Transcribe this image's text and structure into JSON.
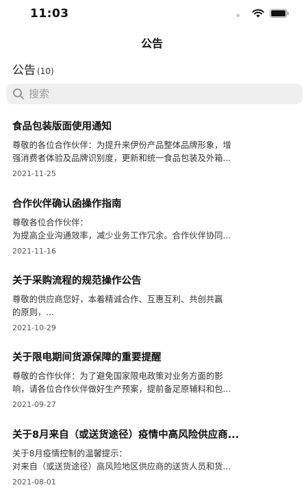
{
  "status_bar": {
    "time": "11:03"
  },
  "nav": {
    "title": "公告"
  },
  "section": {
    "title": "公告",
    "count": "(10)"
  },
  "search": {
    "placeholder": "搜索"
  },
  "notices": [
    {
      "title": "食品包装版面使用通知",
      "lines": [
        "尊敬的各位合作伙伴：为提升来伊份产品整体品牌形象，增",
        "强消费者体验及品牌识别度，更新和统一食品包装及外箱..."
      ],
      "date": "2021-11-25"
    },
    {
      "title": "合作伙伴确认函操作指南",
      "lines": [
        "尊敬各位合作伙伴：",
        "为提高企业沟通效率，减少业务工作冗余。合作伙伴协同..."
      ],
      "date": "2021-11-16"
    },
    {
      "title": "关于采购流程的规范操作公告",
      "lines": [
        "尊敬的供应商您好，本着精诚合作、互惠互利、共创共赢",
        "的原则，..."
      ],
      "date": "2021-10-29"
    },
    {
      "title": "关于限电期间货源保障的重要提醒",
      "lines": [
        "尊敬的合作伙伴：为了避免国家限电政策对业务方面的影",
        "响，请各位合作伙伴做好生产预案，提前备足原辅料和包..."
      ],
      "date": "2021-09-27"
    },
    {
      "title": "关于8月来自（或送货途径）疫情中高风险供应商...",
      "lines": [
        "关于8月疫情控制的温馨提示：",
        "对来自（或送货途径）高风险地区供应商的送货人员和货..."
      ],
      "date": "2021-08-01"
    }
  ]
}
